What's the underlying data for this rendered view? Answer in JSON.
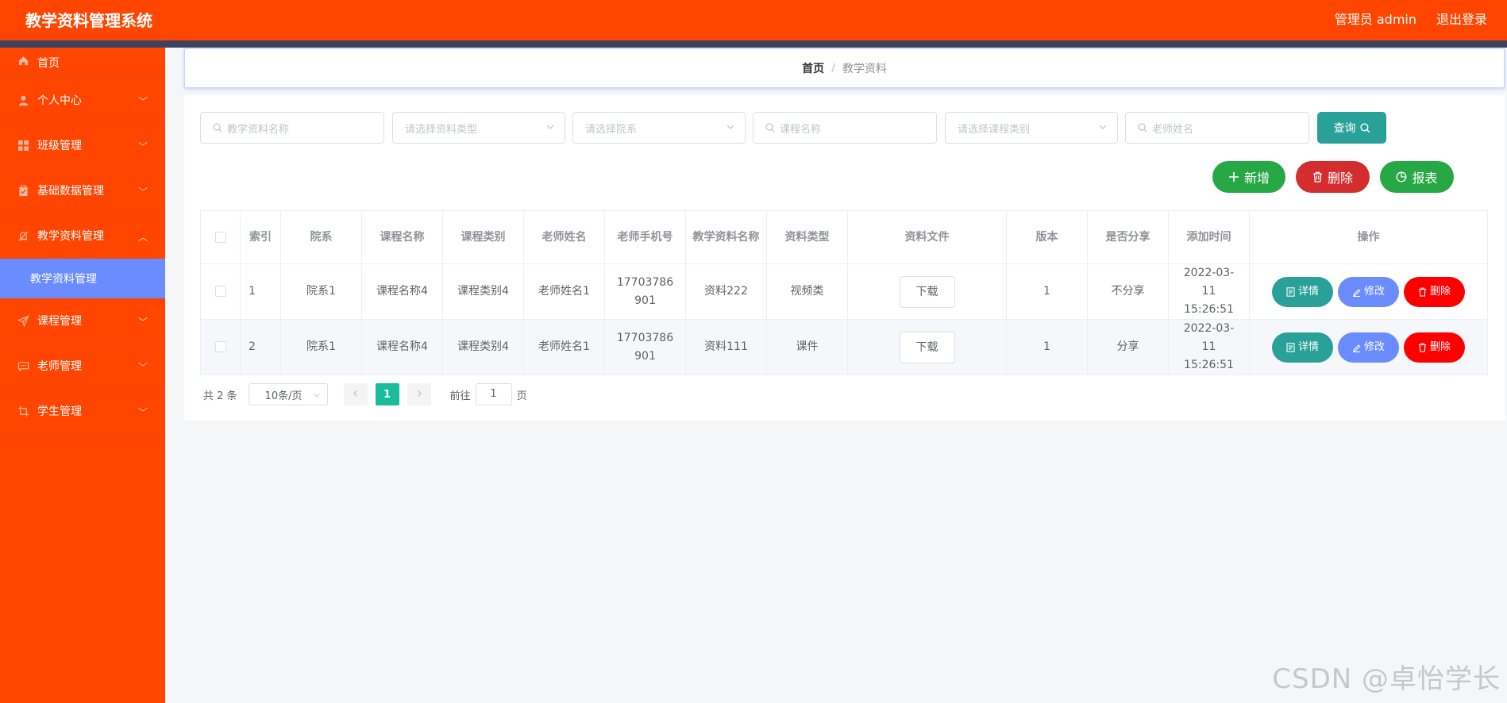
{
  "app": {
    "title": "教学资料管理系统",
    "user_label": "管理员 admin",
    "logout_label": "退出登录"
  },
  "sidebar": {
    "items": [
      {
        "label": "首页",
        "icon": "home-icon"
      },
      {
        "label": "个人中心",
        "icon": "user-icon"
      },
      {
        "label": "班级管理",
        "icon": "grid-icon"
      },
      {
        "label": "基础数据管理",
        "icon": "clipboard-icon"
      },
      {
        "label": "教学资料管理",
        "icon": "bell-off-icon",
        "expanded": true
      },
      {
        "label": "课程管理",
        "icon": "send-icon"
      },
      {
        "label": "老师管理",
        "icon": "message-icon"
      },
      {
        "label": "学生管理",
        "icon": "crop-icon"
      }
    ],
    "submenu_active": "教学资料管理",
    "colors": {
      "bg": "#ff4500",
      "active": "#6b8cff"
    }
  },
  "breadcrumb": {
    "home": "首页",
    "separator": "/",
    "current": "教学资料"
  },
  "search": {
    "material_name_placeholder": "教学资料名称",
    "material_type_placeholder": "请选择资料类型",
    "department_placeholder": "请选择院系",
    "course_name_placeholder": "课程名称",
    "course_type_placeholder": "请选择课程类别",
    "teacher_name_placeholder": "老师姓名",
    "query_label": "查询"
  },
  "actions": {
    "add_label": "新增",
    "delete_label": "删除",
    "report_label": "报表"
  },
  "table": {
    "columns": [
      "索引",
      "院系",
      "课程名称",
      "课程类别",
      "老师姓名",
      "老师手机号",
      "教学资料名称",
      "资料类型",
      "资料文件",
      "版本",
      "是否分享",
      "添加时间",
      "操作"
    ],
    "rows": [
      {
        "index": "1",
        "department": "院系1",
        "course_name": "课程名称4",
        "course_type": "课程类别4",
        "teacher_name": "老师姓名1",
        "teacher_phone": "17703786901",
        "material_name": "资料222",
        "material_type": "视频类",
        "file_button": "下载",
        "version": "1",
        "shared": "不分享",
        "added_time": "2022-03-11 15:26:51"
      },
      {
        "index": "2",
        "department": "院系1",
        "course_name": "课程名称4",
        "course_type": "课程类别4",
        "teacher_name": "老师姓名1",
        "teacher_phone": "17703786901",
        "material_name": "资料111",
        "material_type": "课件",
        "file_button": "下载",
        "version": "1",
        "shared": "分享",
        "added_time": "2022-03-11 15:26:51"
      }
    ],
    "row_actions": {
      "detail": "详情",
      "edit": "修改",
      "delete": "删除"
    }
  },
  "pagination": {
    "total_text": "共 2 条",
    "page_size": "10条/页",
    "current_page": "1",
    "goto_label": "前往",
    "goto_value": "1",
    "page_suffix": "页"
  },
  "watermark": "CSDN @卓怡学长",
  "colors": {
    "accent": "#ff4500",
    "teal": "#2aa198",
    "green": "#28a745",
    "red": "#d42d2d",
    "blue": "#6b8cff",
    "danger": "#ff0000"
  }
}
